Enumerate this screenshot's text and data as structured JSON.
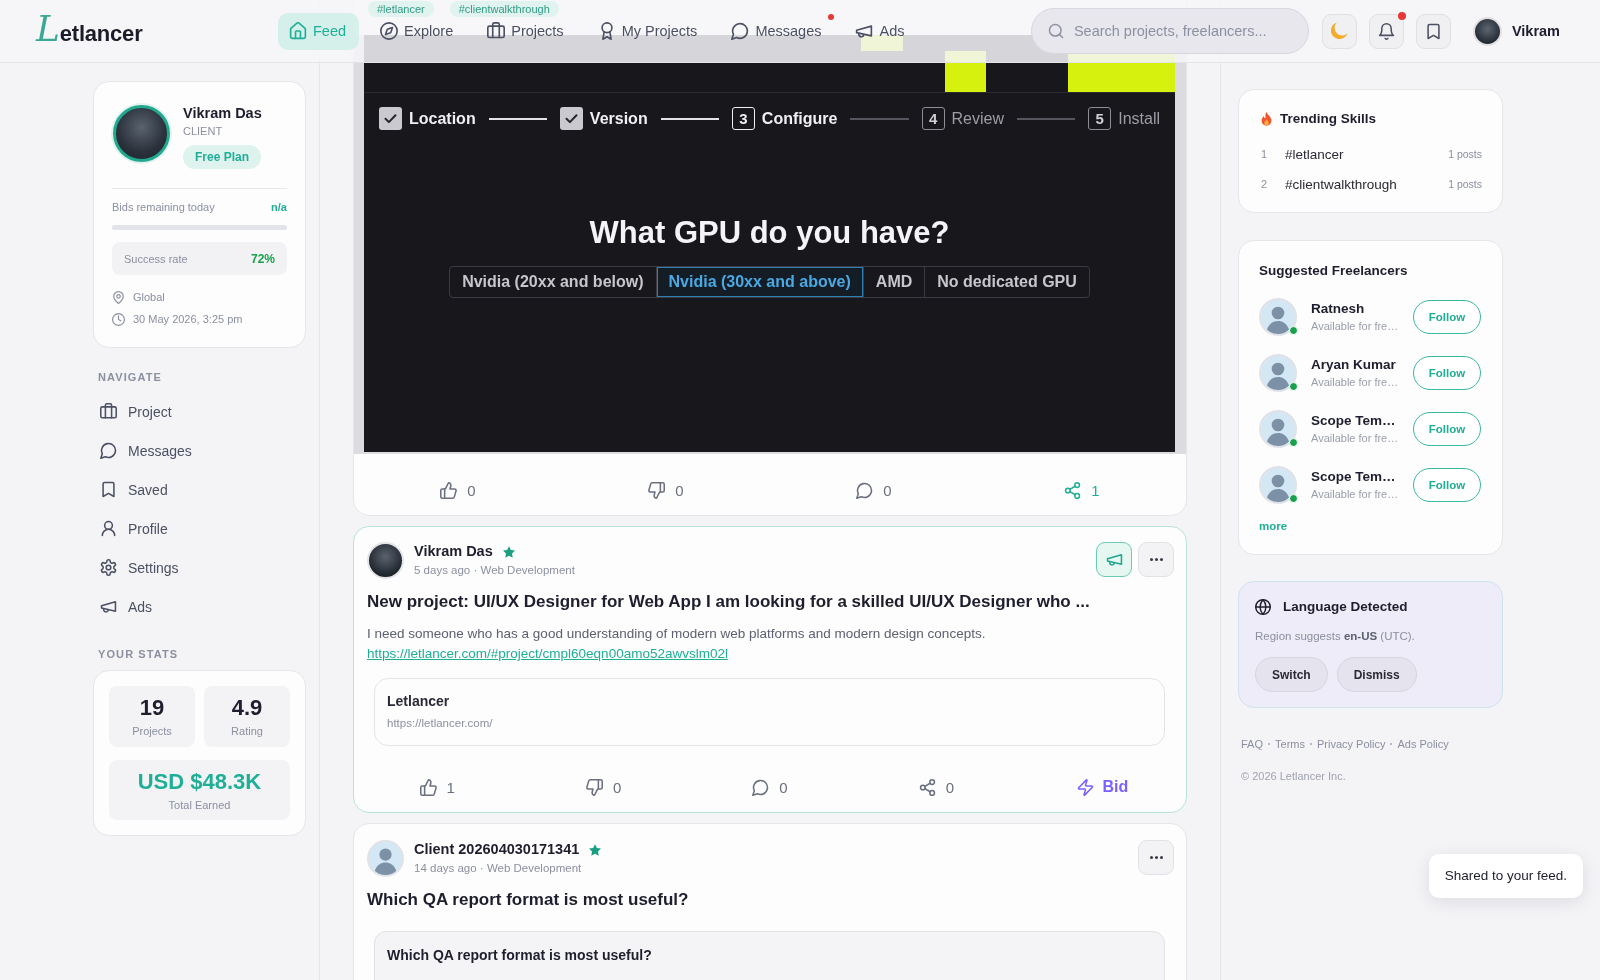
{
  "nav": {
    "logo": "Letlancer",
    "items": [
      {
        "kind": "feed",
        "label": "Feed",
        "selected": true,
        "unread": false
      },
      {
        "kind": "explore",
        "label": "Explore",
        "selected": false,
        "unread": false
      },
      {
        "kind": "projects",
        "label": "Projects",
        "selected": false,
        "unread": false
      },
      {
        "kind": "my_projects",
        "label": "My Projects",
        "selected": false,
        "unread": false
      },
      {
        "kind": "messages",
        "label": "Messages",
        "selected": false,
        "unread": true
      },
      {
        "kind": "ads",
        "label": "Ads",
        "selected": false,
        "unread": false
      }
    ],
    "search": {
      "placeholder": "Search projects, freelancers..."
    },
    "actions": [
      {
        "kind": "theme",
        "unread": false
      },
      {
        "kind": "notifications",
        "unread": true
      },
      {
        "kind": "saved",
        "unread": false
      }
    ],
    "user": {
      "name": "Vikram"
    }
  },
  "profile": {
    "name": "Vikram Das",
    "role": "CLIENT",
    "plan": "Free Plan",
    "bids": {
      "label": "Bids remaining today",
      "value": "n/a",
      "level": 0
    },
    "success": {
      "label": "Success rate",
      "value": "72%"
    },
    "location": "Global",
    "datetime": "30 May 2026, 3:25 pm"
  },
  "navigate": {
    "heading": "NAVIGATE",
    "items": [
      {
        "kind": "project",
        "label": "Project",
        "selected": false
      },
      {
        "kind": "messages",
        "label": "Messages",
        "selected": false
      },
      {
        "kind": "saved",
        "label": "Saved",
        "selected": false
      },
      {
        "kind": "profile",
        "label": "Profile",
        "selected": false
      },
      {
        "kind": "settings",
        "label": "Settings",
        "selected": false
      },
      {
        "kind": "ads",
        "label": "Ads",
        "selected": false
      }
    ]
  },
  "stats": {
    "heading": "YOUR STATS",
    "tiles": [
      {
        "value": "19",
        "label": "Projects"
      },
      {
        "value": "4.9",
        "label": "Rating"
      }
    ],
    "earned": {
      "value": "USD $48.3K",
      "label": "Total Earned"
    }
  },
  "feed": {
    "posts": [
      {
        "highlighted": false,
        "tags": [
          "#letlancer",
          "#clientwalkthrough"
        ],
        "media": {
          "steps": [
            {
              "kind": "done",
              "label": "Location"
            },
            {
              "kind": "done",
              "label": "Version"
            },
            {
              "kind": "current",
              "number": "3",
              "label": "Configure"
            },
            {
              "kind": "todo",
              "number": "4",
              "label": "Review"
            },
            {
              "kind": "todo",
              "number": "5",
              "label": "Install"
            }
          ],
          "question": "What GPU do you have?",
          "options": [
            {
              "label": "Nvidia (20xx and below)",
              "selected": false
            },
            {
              "label": "Nvidia (30xx and above)",
              "selected": true
            },
            {
              "label": "AMD",
              "selected": false
            },
            {
              "label": "No dedicated GPU",
              "selected": false
            }
          ]
        },
        "reactions": [
          {
            "kind": "like",
            "count": "0",
            "active": false
          },
          {
            "kind": "dislike",
            "count": "0",
            "active": false
          },
          {
            "kind": "comment",
            "count": "0",
            "active": false
          },
          {
            "kind": "share",
            "count": "1",
            "active": true
          }
        ]
      },
      {
        "highlighted": true,
        "author": {
          "kind": "photo",
          "name": "Vikram Das",
          "verified": true
        },
        "meta": "5 days ago · Web Development",
        "actions": [
          {
            "kind": "promote"
          },
          {
            "kind": "more"
          }
        ],
        "title": "New project: UI/UX Designer for Web App I am looking for a skilled UI/UX Designer who ...",
        "body": "I need someone who has a good understanding of modern web platforms and modern design concepts.",
        "link": "https://letlancer.com/#project/cmpl60eqn00amo52awvslm02l",
        "preview": {
          "title": "Letlancer",
          "url": "https://letlancer.com/"
        },
        "reactions": [
          {
            "kind": "like",
            "count": "1",
            "active": false
          },
          {
            "kind": "dislike",
            "count": "0",
            "active": false
          },
          {
            "kind": "comment",
            "count": "0",
            "active": false
          },
          {
            "kind": "share",
            "count": "0",
            "active": false
          },
          {
            "kind": "bid",
            "label": "Bid",
            "active": false
          }
        ]
      },
      {
        "highlighted": false,
        "author": {
          "kind": "cartoon",
          "name": "Client 202604030171341",
          "verified": true
        },
        "meta": "14 days ago · Web Development",
        "actions": [
          {
            "kind": "more"
          }
        ],
        "title": "Which QA report format is most useful?",
        "poll": {
          "question": "Which QA report format is most useful?"
        }
      }
    ]
  },
  "trending": {
    "title": "Trending Skills",
    "items": [
      {
        "rank": "1",
        "tag": "#letlancer",
        "count": "1 posts"
      },
      {
        "rank": "2",
        "tag": "#clientwalkthrough",
        "count": "1 posts"
      }
    ]
  },
  "suggested": {
    "title": "Suggested Freelancers",
    "people": [
      {
        "name": "Ratnesh",
        "status": "Available for fre…",
        "online": true,
        "action": "Follow"
      },
      {
        "name": "Aryan Kumar",
        "status": "Available for fre…",
        "online": true,
        "action": "Follow"
      },
      {
        "name": "Scope Tem…",
        "status": "Available for fre…",
        "online": true,
        "action": "Follow"
      },
      {
        "name": "Scope Tem…",
        "status": "Available for fre…",
        "online": true,
        "action": "Follow"
      }
    ],
    "more": "more"
  },
  "language": {
    "title": "Language Detected",
    "text": "Region suggests **en-US** (UTC).",
    "buttons": [
      "Switch",
      "Dismiss"
    ]
  },
  "footer": {
    "links": [
      "FAQ",
      "Terms",
      "Privacy Policy",
      "Ads Policy"
    ],
    "copyright": "© 2026 Letlancer Inc."
  },
  "toast": {
    "text": "Shared to your feed."
  }
}
